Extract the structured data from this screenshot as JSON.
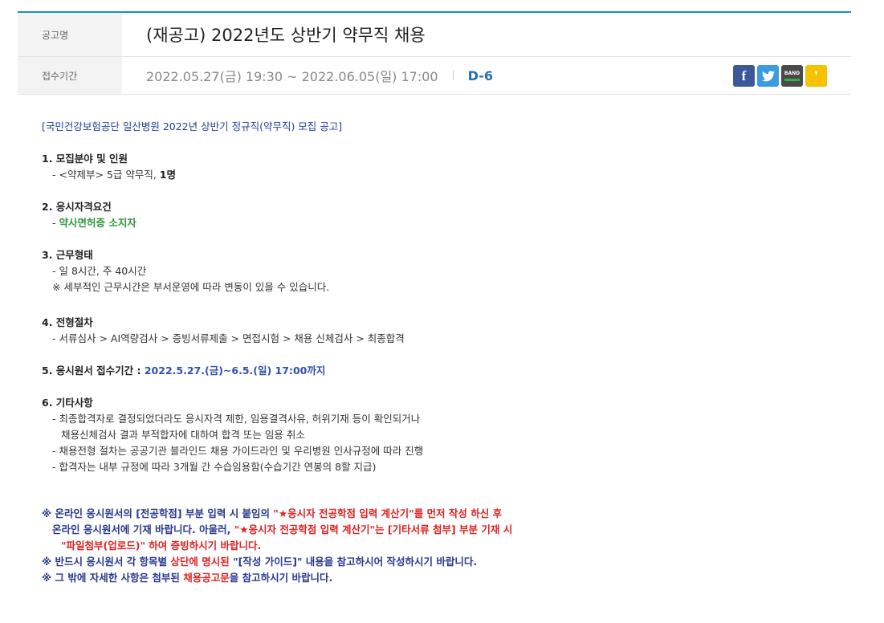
{
  "header": {
    "notice_label": "공고명",
    "notice_title": "(재공고) 2022년도 상반기 약무직 채용",
    "period_label": "접수기간",
    "period_value": "2022.05.27(금) 19:30 ~ 2022.06.05(일) 17:00",
    "dday": "D-6",
    "share": {
      "facebook_icon": "f",
      "twitter_icon": "🐦",
      "band_icon": "BAND",
      "kakao_icon": "❜"
    }
  },
  "body": {
    "intro": "[국민건강보험공단 일산병원 2022년 상반기 정규직(약무직) 모집 공고]",
    "s1_title": "1. 모집분야 및 인원",
    "s1_item_prefix": "- <약제부> 5급 약무직, ",
    "s1_item_bold": "1명",
    "s2_title": "2. 응시자격요건",
    "s2_dash": "- ",
    "s2_item": "약사면허증 소지자",
    "s3_title": "3. 근무형태",
    "s3_item1": "- 일 8시간, 주 40시간",
    "s3_item2": "※ 세부적인 근무시간은 부서운영에 따라 변동이 있을 수 있습니다.",
    "s4_title": "4. 전형절차",
    "s4_item": "- 서류심사 > AI역량검사 > 증빙서류제출 > 면접시험 > 채용 신체검사 > 최종합격",
    "s5_title": "5. 응시원서 접수기간 : ",
    "s5_value": "2022.5.27.(금)~6.5.(일) 17:00까지",
    "s6_title": "6. 기타사항",
    "s6_item1": "- 최종합격자로 결정되었더라도 응시자격 제한, 임용결격사유, 허위기재 등이 확인되거나",
    "s6_item1b": "채용신체검사 결과 부적합자에 대하여 합격 또는 임용 취소",
    "s6_item2": "- 채용전형 절차는 공공기관 블라인드 채용 가이드라인 및 우리병원 인사규정에 따라 진행",
    "s6_item3": "- 합격자는 내부 규정에 따라 3개월 간 수습임용함(수습기간 연봉의 8할 지급)"
  },
  "notes": {
    "n1_a": "※ 온라인 응시원서의 [전공학점] 부분 입력 시 붙임의 ",
    "n1_b": "\"★응시자 전공학점 입력 계산기\"를 먼저 작성 하신 후",
    "n2_a": "온라인 응시원서에 기재 바랍니다. 아울러, ",
    "n2_b": "\"★응시자 전공학점 입력 계산기\"",
    "n2_c": "는 [기타서류 첨부] 부분 기재 시",
    "n3": "\"파일첨부(업로드)\" 하여 증빙하시기 바랍니다.",
    "n4_a": "※ 반드시 응시원서 각 항목별 ",
    "n4_b": "상단에 명시된",
    "n4_c": " \"[작성 가이드]\" 내용을 참고하시어 작성하시기 바랍니다.",
    "n5_a": "※ 그 밖에 자세한 사항은 첨부된 ",
    "n5_b": "채용공고문",
    "n5_c": "을 참고하시기 바랍니다."
  }
}
